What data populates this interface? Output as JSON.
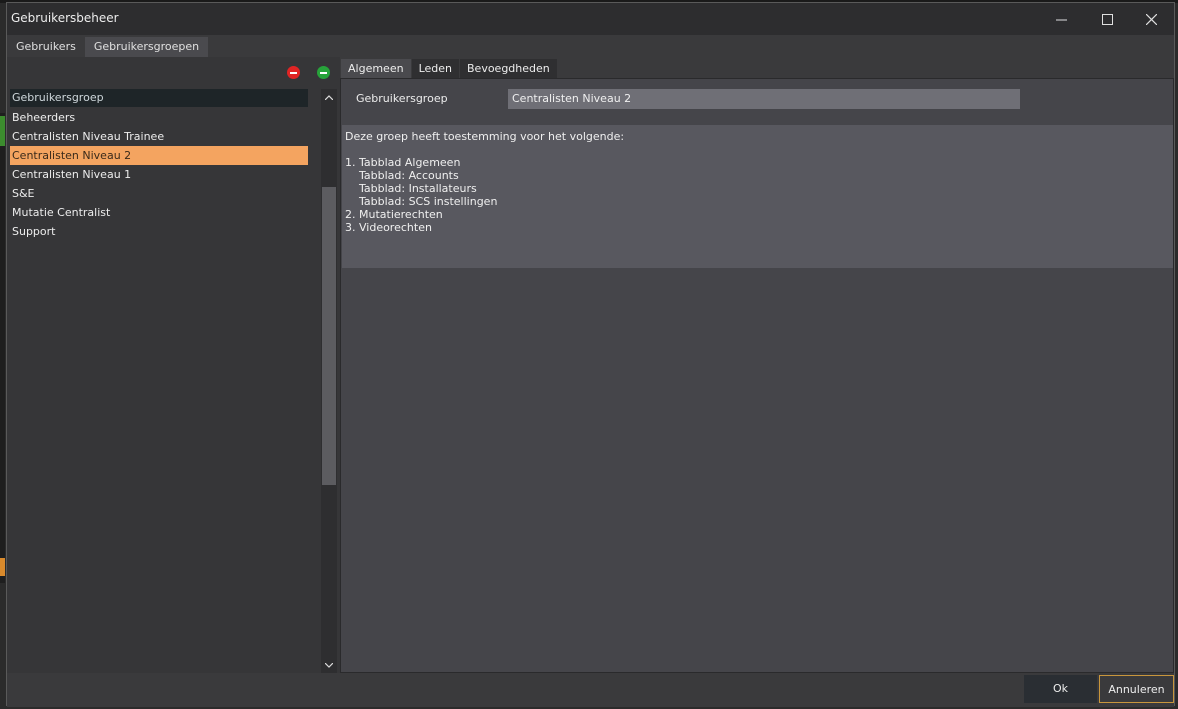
{
  "window": {
    "title": "Gebruikersbeheer"
  },
  "main_tabs": [
    {
      "label": "Gebruikers",
      "active": false
    },
    {
      "label": "Gebruikersgroepen",
      "active": true
    }
  ],
  "group_list": {
    "header": "Gebruikersgroep",
    "items": [
      {
        "label": "Beheerders",
        "selected": false
      },
      {
        "label": "Centralisten Niveau Trainee",
        "selected": false
      },
      {
        "label": "Centralisten Niveau 2",
        "selected": true
      },
      {
        "label": "Centralisten Niveau 1",
        "selected": false
      },
      {
        "label": "S&E",
        "selected": false
      },
      {
        "label": "Mutatie Centralist",
        "selected": false
      },
      {
        "label": "Support",
        "selected": false
      }
    ]
  },
  "sub_tabs": [
    {
      "label": "Algemeen",
      "active": true
    },
    {
      "label": "Leden",
      "active": false
    },
    {
      "label": "Bevoegdheden",
      "active": false
    }
  ],
  "general": {
    "group_label": "Gebruikersgroep",
    "group_value": "Centralisten Niveau 2",
    "description": "Deze groep heeft toestemming voor het volgende:\n\n1. Tabblad Algemeen\n    Tabblad: Accounts\n    Tabblad: Installateurs\n    Tabblad: SCS instellingen\n2. Mutatierechten\n3. Videorechten"
  },
  "footer": {
    "ok_label": "Ok",
    "cancel_label": "Annuleren"
  },
  "colors": {
    "selection": "#f4a460",
    "remove": "#e02424",
    "add": "#27a33a",
    "cancel_border": "#c8963c"
  }
}
